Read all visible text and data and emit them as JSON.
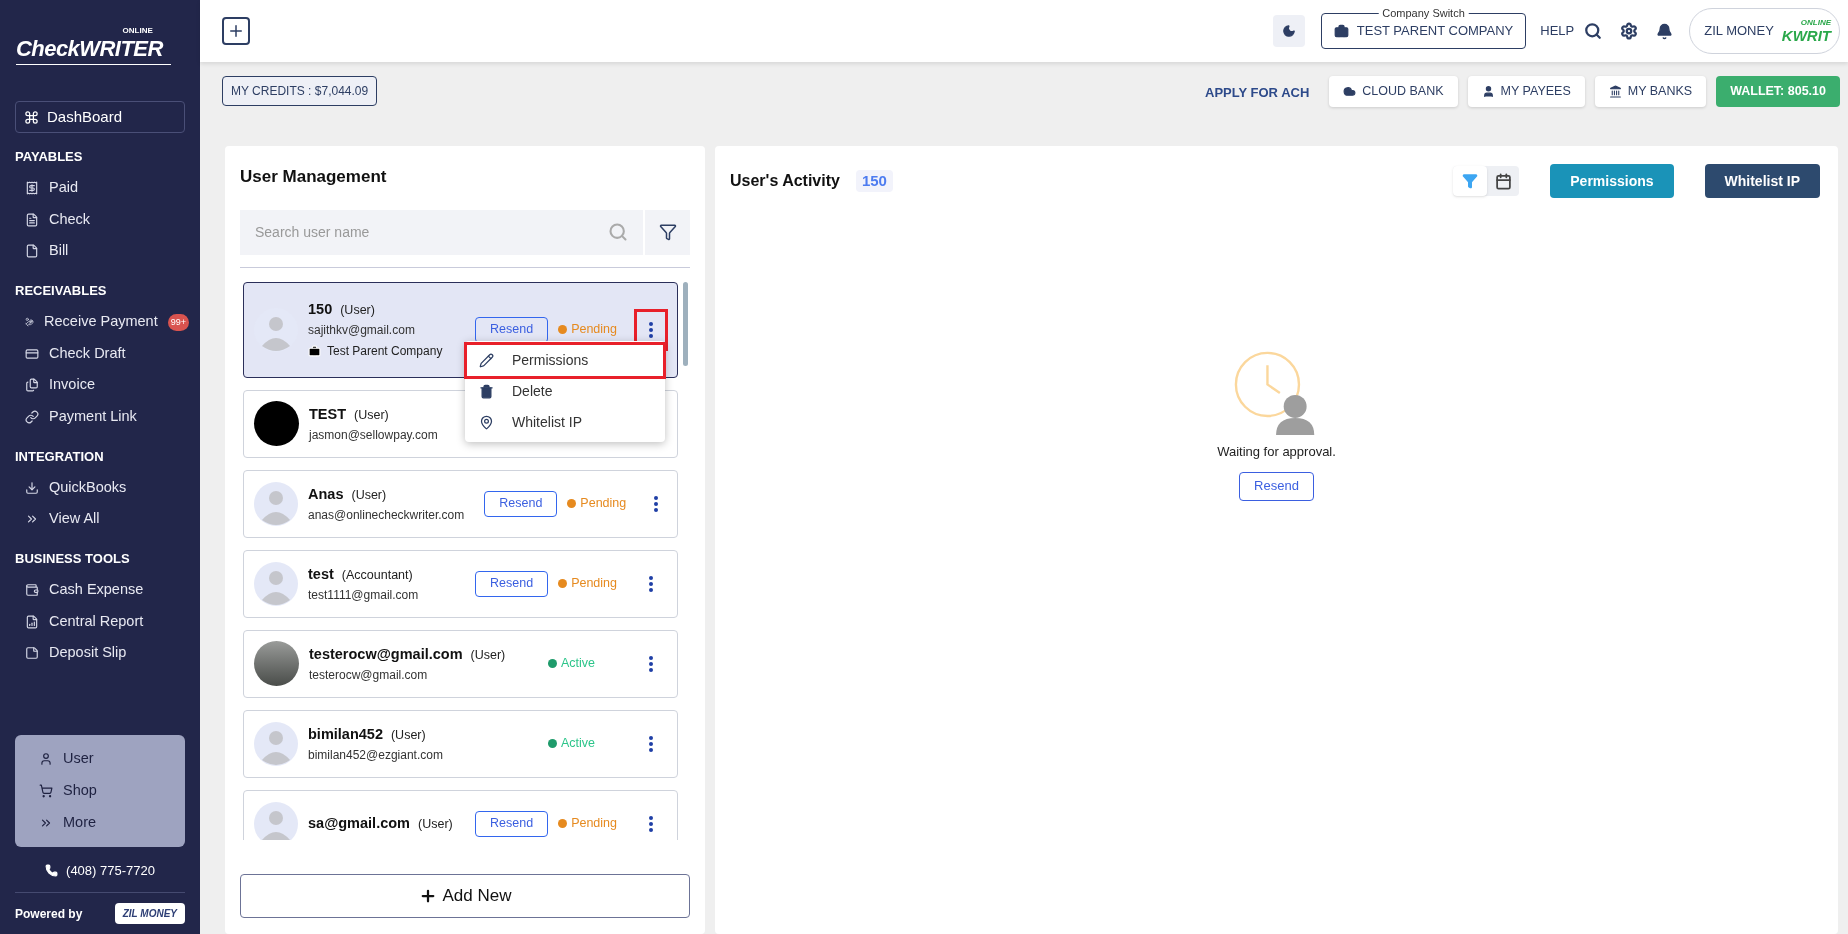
{
  "sidebar": {
    "logo": {
      "small": "ONLINE",
      "main": "CheckWRITER"
    },
    "dashboard": "DashBoard",
    "sections": [
      {
        "title": "PAYABLES",
        "items": [
          {
            "label": "Paid"
          },
          {
            "label": "Check"
          },
          {
            "label": "Bill"
          }
        ]
      },
      {
        "title": "RECEIVABLES",
        "items": [
          {
            "label": "Receive Payment",
            "badge": "99+"
          },
          {
            "label": "Check Draft"
          },
          {
            "label": "Invoice"
          },
          {
            "label": "Payment Link"
          }
        ]
      },
      {
        "title": "INTEGRATION",
        "items": [
          {
            "label": "QuickBooks"
          },
          {
            "label": "View All"
          }
        ]
      },
      {
        "title": "BUSINESS TOOLS",
        "items": [
          {
            "label": "Cash Expense"
          },
          {
            "label": "Central Report"
          },
          {
            "label": "Deposit Slip"
          }
        ]
      }
    ],
    "bottom_menu": [
      "User",
      "Shop",
      "More"
    ],
    "phone": "(408) 775-7720",
    "powered_by": "Powered by",
    "powered_logo": "ZIL MONEY"
  },
  "topbar": {
    "company_switch_label": "Company Switch",
    "company": "TEST PARENT COMPANY",
    "help": "HELP",
    "account": "ZIL MONEY",
    "account_logo": {
      "small": "ONLINE",
      "main": "KWRIT"
    }
  },
  "subbar": {
    "credits": "MY CREDITS : $7,044.09",
    "apply": "APPLY FOR ACH",
    "buttons": [
      "CLOUD BANK",
      "MY PAYEES",
      "MY BANKS"
    ],
    "wallet": "WALLET: 805.10"
  },
  "user_management": {
    "title": "User Management",
    "search": {
      "placeholder": "Search user name"
    },
    "users": [
      {
        "name": "150",
        "role": "(User)",
        "email": "sajithkv@gmail.com",
        "company": "Test Parent Company",
        "selected": true,
        "resend": "Resend",
        "status": "Pending",
        "kind": "pending",
        "menu_highlighted": true
      },
      {
        "name": "TEST",
        "role": "(User)",
        "email": "jasmon@sellowpay.com",
        "selected": false,
        "menu_highlighted": false
      },
      {
        "name": "Anas",
        "role": "(User)",
        "email": "anas@onlinecheckwriter.com",
        "selected": false,
        "resend": "Resend",
        "status": "Pending",
        "kind": "pending",
        "menu_highlighted": false
      },
      {
        "name": "test",
        "role": "(Accountant)",
        "email": "test1111@gmail.com",
        "selected": false,
        "resend": "Resend",
        "status": "Pending",
        "kind": "pending",
        "menu_highlighted": false
      },
      {
        "name": "testerocw@gmail.com",
        "role": "(User)",
        "email": "testerocw@gmail.com",
        "selected": false,
        "status": "Active",
        "kind": "active",
        "menu_highlighted": false
      },
      {
        "name": "bimilan452",
        "role": "(User)",
        "email": "bimilan452@ezgiant.com",
        "selected": false,
        "status": "Active",
        "kind": "active",
        "menu_highlighted": false
      },
      {
        "name": "sa@gmail.com",
        "role": "(User)",
        "selected": false,
        "resend": "Resend",
        "status": "Pending",
        "kind": "pending",
        "menu_highlighted": false
      }
    ],
    "menu": [
      {
        "label": "Permissions",
        "highlighted": true
      },
      {
        "label": "Delete",
        "highlighted": false
      },
      {
        "label": "Whitelist IP",
        "highlighted": false
      }
    ],
    "add_new": "Add New"
  },
  "activity": {
    "title": "User's Activity",
    "count": "150",
    "permissions": "Permissions",
    "whitelist": "Whitelist IP",
    "message": "Waiting for approval.",
    "resend": "Resend"
  }
}
